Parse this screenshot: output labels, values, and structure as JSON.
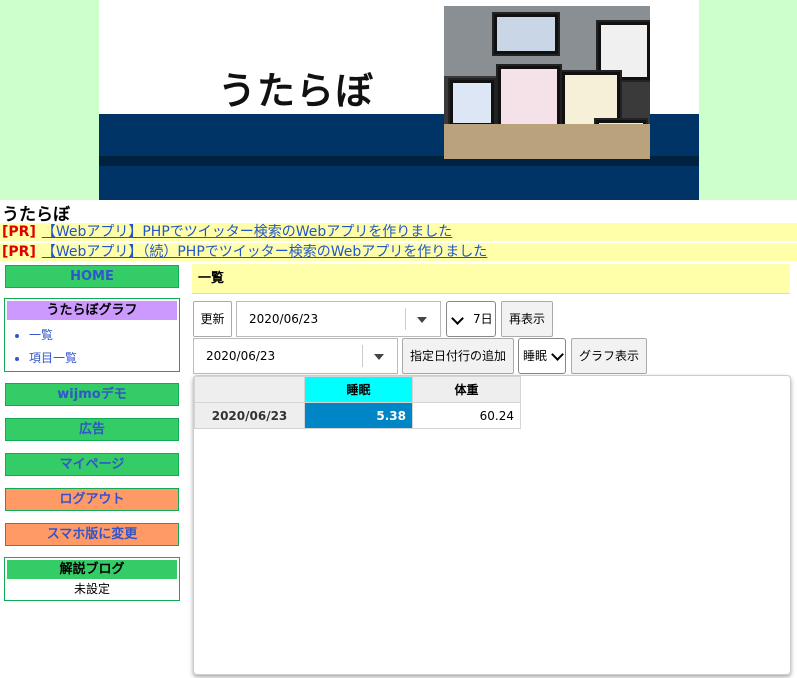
{
  "banner": {
    "logo_text": "うたらぼ"
  },
  "site_title": "うたらぼ",
  "pr_links": [
    {
      "tag": "[PR]",
      "text": "【Webアプリ】PHPでツイッター検索のWebアプリを作りました"
    },
    {
      "tag": "[PR]",
      "text": "【Webアプリ】（続）PHPでツイッター検索のWebアプリを作りました"
    }
  ],
  "sidebar": {
    "home": "HOME",
    "graph_box": {
      "title": "うたらぼグラフ",
      "items": [
        "一覧",
        "項目一覧"
      ]
    },
    "wijmo": "wijmoデモ",
    "ads": "広告",
    "mypage": "マイページ",
    "logout": "ログアウト",
    "smartphone": "スマホ版に変更",
    "blog_box": {
      "title": "解説ブログ",
      "value": "未設定"
    }
  },
  "main": {
    "header": "一覧",
    "toolbar1": {
      "refresh": "更新",
      "date": "2020/06/23",
      "range": "7日",
      "redisplay": "再表示"
    },
    "toolbar2": {
      "date": "2020/06/23",
      "add_row": "指定日付行の追加",
      "item": "睡眠",
      "graph": "グラフ表示"
    },
    "grid": {
      "columns": [
        "睡眠",
        "体重"
      ],
      "rows": [
        {
          "date": "2020/06/23",
          "values": [
            "5.38",
            "60.24"
          ]
        }
      ]
    }
  },
  "colors": {
    "banner_bg": "#ccffcc",
    "pr_bg": "#ffffaa",
    "side_green": "#33cc66",
    "side_orange": "#ff9966",
    "selected_cell": "#0085c7",
    "active_header": "#00ffff"
  }
}
